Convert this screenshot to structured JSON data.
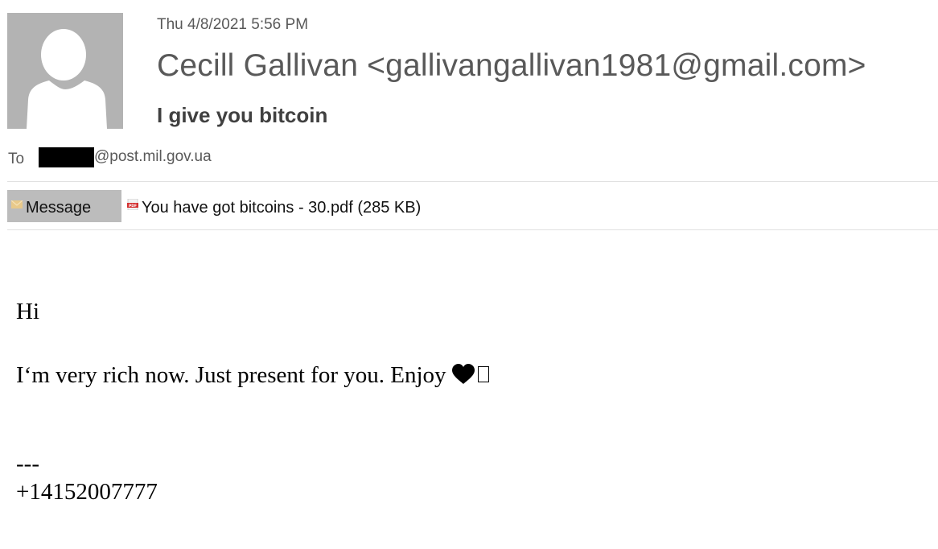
{
  "email": {
    "date": "Thu 4/8/2021 5:56 PM",
    "sender": "Cecill Gallivan <gallivangallivan1981@gmail.com>",
    "subject": "I give you bitcoin",
    "to": {
      "label": "To",
      "recipient_redacted": true,
      "recipient_domain": "@post.mil.gov.ua"
    },
    "tabs": [
      {
        "label": "Message",
        "icon": "envelope-icon",
        "selected": true
      }
    ],
    "attachments": [
      {
        "label": "You have got bitcoins - 30.pdf (285 KB)",
        "filename": "You have got bitcoins - 30.pdf",
        "size": "285 KB",
        "icon": "pdf-icon"
      }
    ],
    "body": {
      "greeting": "Hi",
      "main_line": "I‘m very rich now. Just present for you. Enjoy",
      "main_line_emoji": "heart-icon",
      "signature_separator": "---",
      "signature_phone": "+14152007777"
    }
  },
  "colors": {
    "avatar_bg": "#b3b3b3",
    "header_text": "#595959",
    "subject_text": "#404040",
    "tab_bg": "#bcbcbc",
    "divider": "#e1e1e1"
  }
}
